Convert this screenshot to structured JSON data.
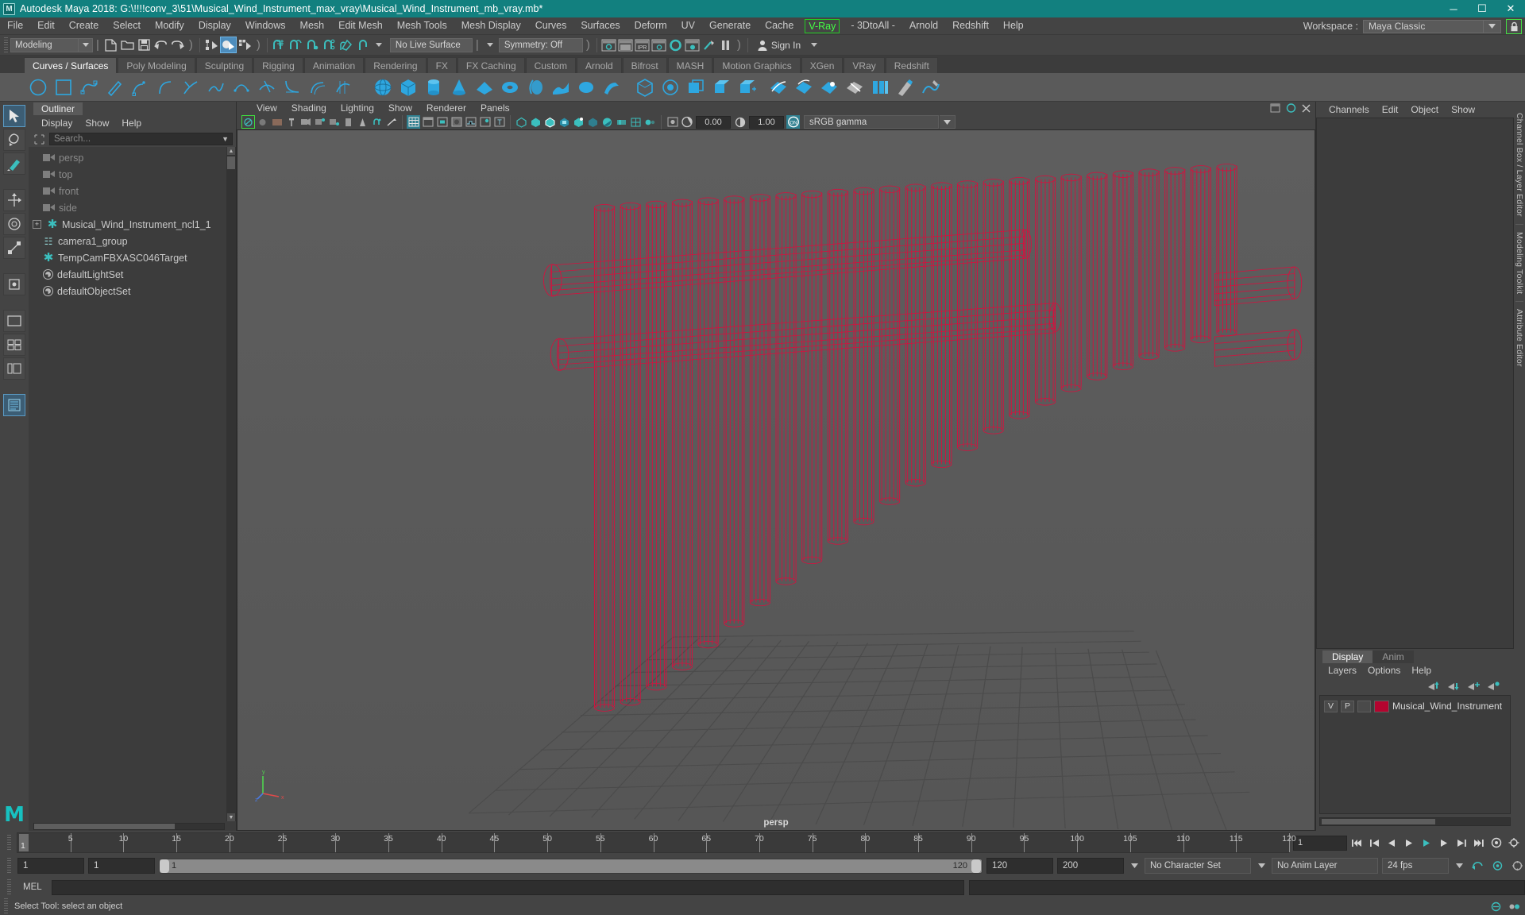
{
  "window": {
    "title": "Autodesk Maya 2018: G:\\!!!!conv_3\\51\\Musical_Wind_Instrument_max_vray\\Musical_Wind_Instrument_mb_vray.mb*",
    "app_icon": "M",
    "minimize": "─",
    "maximize": "☐",
    "close": "✕",
    "title_bg": "#12807f"
  },
  "menubar": {
    "items": [
      {
        "label": "File"
      },
      {
        "label": "Edit"
      },
      {
        "label": "Create"
      },
      {
        "label": "Select"
      },
      {
        "label": "Modify"
      },
      {
        "label": "Display"
      },
      {
        "label": "Windows"
      },
      {
        "label": "Mesh"
      },
      {
        "label": "Edit Mesh"
      },
      {
        "label": "Mesh Tools"
      },
      {
        "label": "Mesh Display"
      },
      {
        "label": "Curves"
      },
      {
        "label": "Surfaces"
      },
      {
        "label": "Deform"
      },
      {
        "label": "UV"
      },
      {
        "label": "Generate"
      },
      {
        "label": "Cache"
      },
      {
        "label": "V-Ray"
      },
      {
        "label": "- 3DtoAll -"
      },
      {
        "label": "Arnold"
      },
      {
        "label": "Redshift"
      },
      {
        "label": "Help"
      }
    ],
    "vray_label": "V-Ray",
    "vray_color": "#44ff44",
    "workspace_label": "Workspace :",
    "workspace_value": "Maya Classic",
    "lock_icon": "lock-icon"
  },
  "statusbar": {
    "menu_set": "Modeling",
    "live_surface": "No Live Surface",
    "symmetry": "Symmetry: Off",
    "sign_in": "Sign In"
  },
  "shelf": {
    "tabs": [
      {
        "label": "Curves / Surfaces",
        "selected": true
      },
      {
        "label": "Poly Modeling",
        "selected": false
      },
      {
        "label": "Sculpting",
        "selected": false
      },
      {
        "label": "Rigging",
        "selected": false
      },
      {
        "label": "Animation",
        "selected": false
      },
      {
        "label": "Rendering",
        "selected": false
      },
      {
        "label": "FX",
        "selected": false
      },
      {
        "label": "FX Caching",
        "selected": false
      },
      {
        "label": "Custom",
        "selected": false
      },
      {
        "label": "Arnold",
        "selected": false
      },
      {
        "label": "Bifrost",
        "selected": false
      },
      {
        "label": "MASH",
        "selected": false
      },
      {
        "label": "Motion Graphics",
        "selected": false
      },
      {
        "label": "XGen",
        "selected": false
      },
      {
        "label": "VRay",
        "selected": false
      },
      {
        "label": "Redshift",
        "selected": false
      }
    ]
  },
  "outliner": {
    "tab_label": "Outliner",
    "menus": [
      {
        "label": "Display"
      },
      {
        "label": "Show"
      },
      {
        "label": "Help"
      }
    ],
    "search_placeholder": "Search...",
    "items": [
      {
        "label": "persp",
        "icon": "camera-icon",
        "type": "camera",
        "expandable": false
      },
      {
        "label": "top",
        "icon": "camera-icon",
        "type": "camera",
        "expandable": false
      },
      {
        "label": "front",
        "icon": "camera-icon",
        "type": "camera",
        "expandable": false
      },
      {
        "label": "side",
        "icon": "camera-icon",
        "type": "camera",
        "expandable": false
      },
      {
        "label": "Musical_Wind_Instrument_ncl1_1",
        "icon": "transform-icon",
        "type": "node",
        "expandable": true
      },
      {
        "label": "camera1_group",
        "icon": "group-icon",
        "type": "group",
        "expandable": false
      },
      {
        "label": "TempCamFBXASC046Target",
        "icon": "transform-icon",
        "type": "node",
        "expandable": false
      },
      {
        "label": "defaultLightSet",
        "icon": "set-icon",
        "type": "set",
        "expandable": false
      },
      {
        "label": "defaultObjectSet",
        "icon": "set-icon",
        "type": "set",
        "expandable": false
      }
    ]
  },
  "viewport": {
    "menus": [
      {
        "label": "View"
      },
      {
        "label": "Shading"
      },
      {
        "label": "Lighting"
      },
      {
        "label": "Show"
      },
      {
        "label": "Renderer"
      },
      {
        "label": "Panels"
      }
    ],
    "exposure_value": "0.00",
    "gamma_value": "1.00",
    "color_space": "sRGB gamma",
    "camera_label": "persp",
    "wireframe_color": "#d4123f",
    "background_color": "#5a5a5a",
    "grid_color": "#4a4a4a"
  },
  "channelbox": {
    "menus": [
      {
        "label": "Channels"
      },
      {
        "label": "Edit"
      },
      {
        "label": "Object"
      },
      {
        "label": "Show"
      }
    ]
  },
  "layereditor": {
    "tabs": [
      {
        "label": "Display",
        "selected": true
      },
      {
        "label": "Anim",
        "selected": false
      }
    ],
    "menus": [
      {
        "label": "Layers"
      },
      {
        "label": "Options"
      },
      {
        "label": "Help"
      }
    ],
    "layers": [
      {
        "v": "V",
        "p": "P",
        "blank": "",
        "color": "#b4042f",
        "name": "Musical_Wind_Instrument"
      }
    ]
  },
  "vtabs": [
    {
      "label": "Channel Box / Layer Editor"
    },
    {
      "label": "Modeling Toolkit"
    },
    {
      "label": "Attribute Editor"
    }
  ],
  "timeline": {
    "ticks": [
      5,
      10,
      15,
      20,
      25,
      30,
      35,
      40,
      45,
      50,
      55,
      60,
      65,
      70,
      75,
      80,
      85,
      90,
      95,
      100,
      105,
      110,
      115,
      120
    ],
    "current_frame_label": "1",
    "current_frame_field": "1",
    "range_start": "1",
    "range_end": "1",
    "slider_min": "1",
    "slider_max": "120",
    "anim_end": "120",
    "playback_end": "200",
    "character_set": "No Character Set",
    "anim_layer": "No Anim Layer",
    "fps": "24 fps"
  },
  "command": {
    "mel_label": "MEL",
    "mel_input": "",
    "mel_output": ""
  },
  "status": {
    "message": "Select Tool: select an object"
  }
}
